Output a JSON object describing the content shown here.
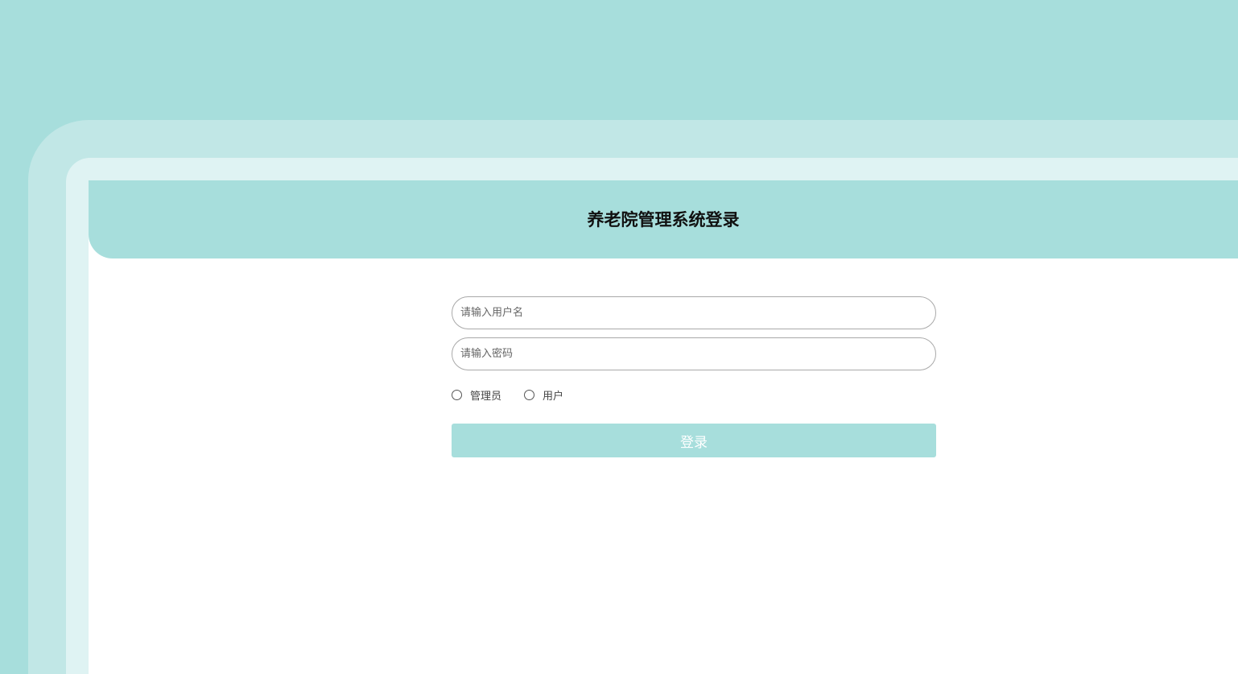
{
  "colors": {
    "accent": "#a7dedc",
    "frame_outer": "#c1e7e6",
    "frame_inner": "#dff3f3",
    "panel": "#ffffff"
  },
  "header": {
    "title": "养老院管理系统登录"
  },
  "login_form": {
    "username": {
      "value": "",
      "placeholder": "请输入用户名"
    },
    "password": {
      "value": "",
      "placeholder": "请输入密码"
    },
    "roles": [
      {
        "label": "管理员",
        "selected": false
      },
      {
        "label": "用户",
        "selected": false
      }
    ],
    "submit_label": "登录"
  }
}
